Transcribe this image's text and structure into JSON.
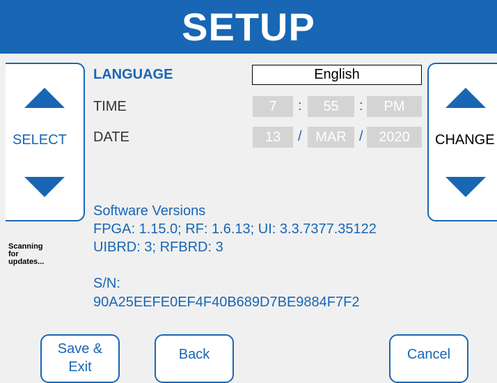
{
  "header": {
    "title": "SETUP"
  },
  "left_panel": {
    "select_label": "SELECT",
    "up_icon": "up-triangle-icon",
    "down_icon": "down-triangle-icon"
  },
  "right_panel": {
    "change_label": "CHANGE",
    "up_icon": "up-triangle-icon",
    "down_icon": "down-triangle-icon"
  },
  "settings": {
    "language": {
      "label": "LANGUAGE",
      "value": "English"
    },
    "time": {
      "label": "TIME",
      "hour": "7",
      "minute": "55",
      "ampm": "PM",
      "sep": ":"
    },
    "date": {
      "label": "DATE",
      "day": "13",
      "month": "MAR",
      "year": "2020",
      "sep": "/"
    }
  },
  "software": {
    "heading": "Software Versions",
    "line1": "FPGA: 1.15.0; RF: 1.6.13; UI: 3.3.7377.35122",
    "line2": "UIBRD: 3; RFBRD: 3",
    "sn_label": "S/N:",
    "sn_value": "90A25EEFE0EF4F40B689D7BE9884F7F2"
  },
  "status": {
    "line1": "Scanning",
    "line2": "for",
    "line3": "updates..."
  },
  "buttons": {
    "save_line1": "Save &",
    "save_line2": "Exit",
    "back": "Back",
    "cancel": "Cancel"
  },
  "colors": {
    "accent": "#1866b4",
    "field_bg": "#d4d4d4",
    "background": "#f0f0f0"
  }
}
